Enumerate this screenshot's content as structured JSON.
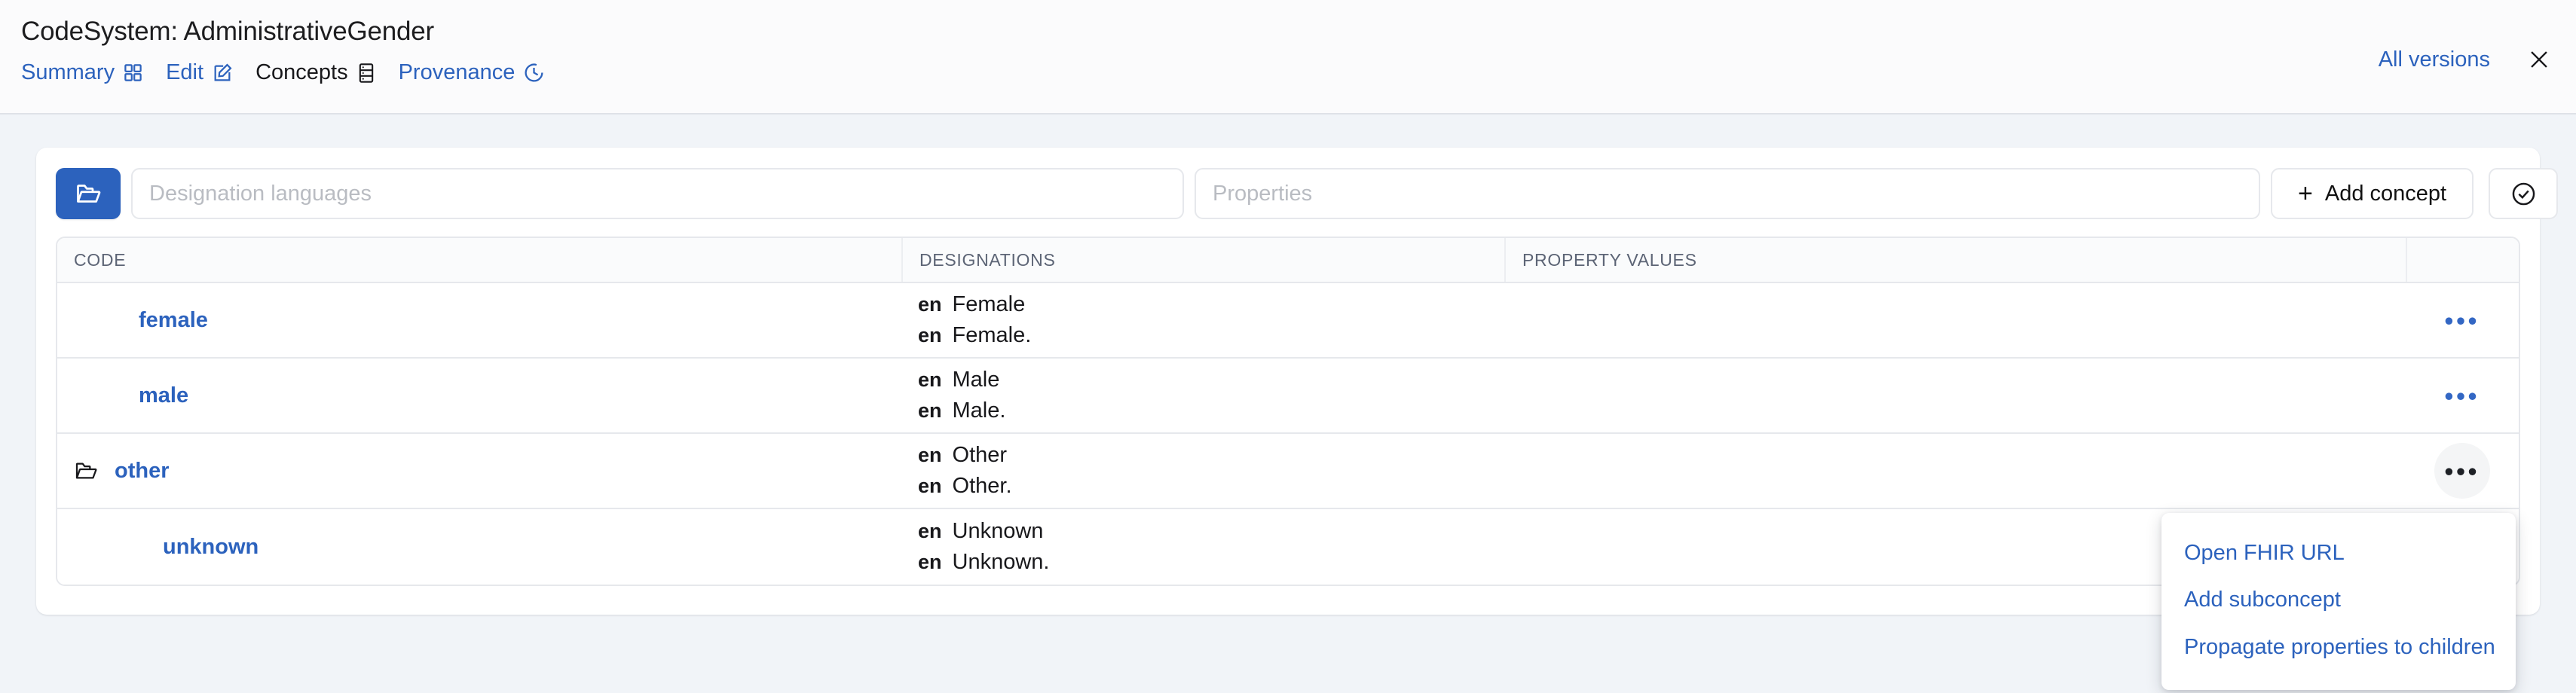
{
  "header": {
    "title": "CodeSystem: AdministrativeGender",
    "nav": [
      {
        "label": "Summary",
        "icon": "grid-icon",
        "active": false
      },
      {
        "label": "Edit",
        "icon": "pencil-icon",
        "active": false
      },
      {
        "label": "Concepts",
        "icon": "list-icon",
        "active": true
      },
      {
        "label": "Provenance",
        "icon": "clock-icon",
        "active": false
      }
    ],
    "all_versions_label": "All versions",
    "close_icon": "close-icon"
  },
  "toolbar": {
    "folder_button_icon": "folder-open-icon",
    "designation_languages_placeholder": "Designation languages",
    "designation_languages_value": "",
    "properties_placeholder": "Properties",
    "properties_value": "",
    "add_concept_label": "Add concept",
    "add_concept_plus": "+",
    "validate_button_icon": "check-circle-icon"
  },
  "table": {
    "columns": [
      "CODE",
      "DESIGNATIONS",
      "PROPERTY VALUES"
    ],
    "rows": [
      {
        "code": "female",
        "indent": 0,
        "has_folder": false,
        "designations": [
          {
            "lang": "en",
            "text": "Female"
          },
          {
            "lang": "en",
            "text": "Female."
          }
        ],
        "property_values": "",
        "actions_icon": "ellipsis-icon",
        "actions_active": false
      },
      {
        "code": "male",
        "indent": 0,
        "has_folder": false,
        "designations": [
          {
            "lang": "en",
            "text": "Male"
          },
          {
            "lang": "en",
            "text": "Male."
          }
        ],
        "property_values": "",
        "actions_icon": "ellipsis-icon",
        "actions_active": false
      },
      {
        "code": "other",
        "indent": 0,
        "has_folder": true,
        "designations": [
          {
            "lang": "en",
            "text": "Other"
          },
          {
            "lang": "en",
            "text": "Other."
          }
        ],
        "property_values": "",
        "actions_icon": "ellipsis-icon",
        "actions_active": true
      },
      {
        "code": "unknown",
        "indent": 1,
        "has_folder": false,
        "designations": [
          {
            "lang": "en",
            "text": "Unknown"
          },
          {
            "lang": "en",
            "text": "Unknown."
          }
        ],
        "property_values": "",
        "actions_icon": "ellipsis-icon",
        "actions_active": false
      }
    ]
  },
  "context_menu": {
    "visible": true,
    "items": [
      "Open FHIR URL",
      "Add subconcept",
      "Propagate properties to children"
    ]
  },
  "colors": {
    "accent_blue": "#2c62bd",
    "page_background": "#f1f4f8",
    "card_background": "#ffffff",
    "border": "#e6e8ec",
    "header_text": "#1d1d1f",
    "muted_text": "#5c6475"
  }
}
